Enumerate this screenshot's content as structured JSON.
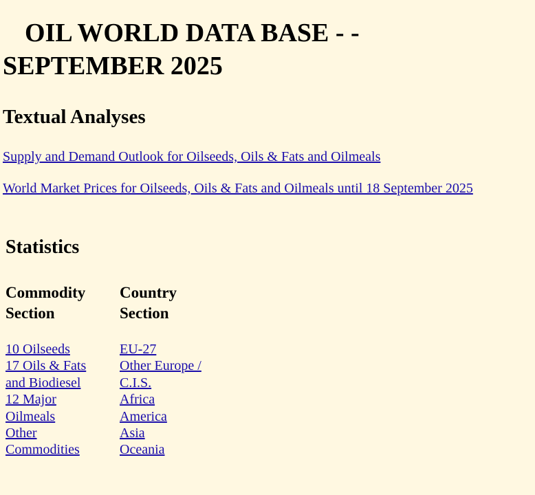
{
  "title": {
    "line1": "OIL WORLD DATA BASE - -",
    "line2": "SEPTEMBER 2025"
  },
  "textual_analyses": {
    "heading": "Textual Analyses",
    "links": [
      "Supply and Demand Outlook for Oilseeds, Oils & Fats and Oilmeals",
      "World Market Prices for Oilseeds, Oils & Fats and Oilmeals until 18 September 2025"
    ]
  },
  "statistics": {
    "heading": "Statistics",
    "commodity_section": {
      "heading_line1": "Commodity",
      "heading_line2": "Section",
      "links": [
        {
          "line1": "10 Oilseeds"
        },
        {
          "line1": "17 Oils & Fats",
          "line2": "and Biodiesel"
        },
        {
          "line1": "12 Major",
          "line2": "Oilmeals"
        },
        {
          "line1": "Other",
          "line2": "Commodities"
        }
      ]
    },
    "country_section": {
      "heading_line1": "Country",
      "heading_line2": "Section",
      "links": [
        {
          "line1": "EU-27"
        },
        {
          "line1": "Other Europe /",
          "line2": "C.I.S."
        },
        {
          "line1": "Africa"
        },
        {
          "line1": "America"
        },
        {
          "line1": "Asia"
        },
        {
          "line1": "Oceania"
        }
      ]
    }
  },
  "colors": {
    "background": "#FFF8E1",
    "link": "#1A0DAB",
    "text": "#000000"
  }
}
